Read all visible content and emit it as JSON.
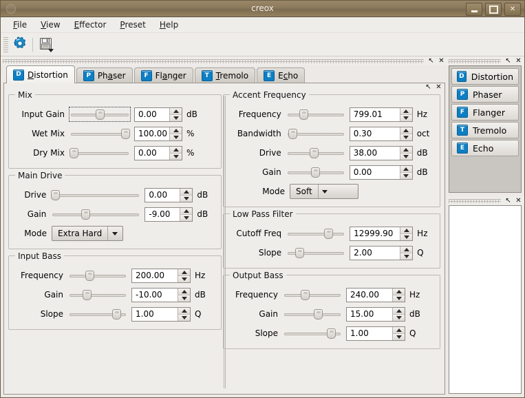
{
  "window": {
    "title": "creox",
    "minimize_label": "–",
    "maximize_label": "□",
    "close_label": "✕"
  },
  "menubar": [
    {
      "label": "File",
      "mnemonic": "F"
    },
    {
      "label": "View",
      "mnemonic": "V"
    },
    {
      "label": "Effector",
      "mnemonic": "E"
    },
    {
      "label": "Preset",
      "mnemonic": "P"
    },
    {
      "label": "Help",
      "mnemonic": "H"
    }
  ],
  "toolbar": {
    "settings_icon": "gear-icon",
    "save_icon": "floppy-save-icon"
  },
  "dock_buttons": {
    "float_label": "↖",
    "close_label": "✕"
  },
  "tabs": [
    {
      "label": "Distortion",
      "mnemonic": "D",
      "badge": "D",
      "active": true
    },
    {
      "label": "Phaser",
      "mnemonic": "a",
      "badge": "P",
      "active": false
    },
    {
      "label": "Flanger",
      "mnemonic": "l",
      "badge": "F",
      "active": false
    },
    {
      "label": "Tremolo",
      "mnemonic": "T",
      "badge": "T",
      "active": false
    },
    {
      "label": "Echo",
      "mnemonic": "c",
      "badge": "E",
      "active": false
    }
  ],
  "groups": {
    "mix": {
      "title": "Mix",
      "label_width": 72,
      "slider_width": 88,
      "spin_width": 70,
      "rows": [
        {
          "label": "Input Gain",
          "value": "0.00",
          "unit": "dB",
          "pos": 50,
          "focused": true
        },
        {
          "label": "Wet Mix",
          "value": "100.00",
          "unit": "%",
          "pos": 100,
          "focused": false
        },
        {
          "label": "Dry Mix",
          "value": "0.00",
          "unit": "%",
          "pos": 0,
          "focused": false
        }
      ]
    },
    "accent_frequency": {
      "title": "Accent Frequency",
      "label_width": 80,
      "slider_width": 86,
      "spin_width": 92,
      "rows": [
        {
          "label": "Frequency",
          "value": "799.01",
          "unit": "Hz",
          "pos": 26
        },
        {
          "label": "Bandwidth",
          "value": "0.30",
          "unit": "oct",
          "pos": 4
        },
        {
          "label": "Drive",
          "value": "38.00",
          "unit": "dB",
          "pos": 47
        },
        {
          "label": "Gain",
          "value": "0.00",
          "unit": "dB",
          "pos": 50
        }
      ],
      "mode_label": "Mode",
      "mode_value": "Soft"
    },
    "main_drive": {
      "title": "Main Drive",
      "label_width": 46,
      "slider_width": 130,
      "spin_width": 70,
      "rows": [
        {
          "label": "Drive",
          "value": "0.00",
          "unit": "dB",
          "pos": 0
        },
        {
          "label": "Gain",
          "value": "-9.00",
          "unit": "dB",
          "pos": 37
        }
      ],
      "mode_label": "Mode",
      "mode_value": "Extra Hard"
    },
    "low_pass_filter": {
      "title": "Low Pass Filter",
      "label_width": 82,
      "slider_width": 86,
      "spin_width": 92,
      "rows": [
        {
          "label": "Cutoff Freq",
          "value": "12999.90",
          "unit": "Hz",
          "pos": 75
        },
        {
          "label": "Slope",
          "value": "2.00",
          "unit": "Q",
          "pos": 17
        }
      ]
    },
    "input_bass": {
      "title": "Input Bass",
      "label_width": 70,
      "slider_width": 86,
      "spin_width": 86,
      "rows": [
        {
          "label": "Frequency",
          "value": "200.00",
          "unit": "Hz",
          "pos": 34
        },
        {
          "label": "Gain",
          "value": "-10.00",
          "unit": "dB",
          "pos": 29
        },
        {
          "label": "Slope",
          "value": "1.00",
          "unit": "Q",
          "pos": 87
        }
      ]
    },
    "output_bass": {
      "title": "Output Bass",
      "label_width": 70,
      "slider_width": 86,
      "spin_width": 86,
      "rows": [
        {
          "label": "Frequency",
          "value": "240.00",
          "unit": "Hz",
          "pos": 36
        },
        {
          "label": "Gain",
          "value": "15.00",
          "unit": "dB",
          "pos": 62
        },
        {
          "label": "Slope",
          "value": "1.00",
          "unit": "Q",
          "pos": 88
        }
      ]
    }
  },
  "effector_dock": {
    "items": [
      {
        "label": "Distortion",
        "badge": "D"
      },
      {
        "label": "Phaser",
        "badge": "P"
      },
      {
        "label": "Flanger",
        "badge": "F"
      },
      {
        "label": "Tremolo",
        "badge": "T"
      },
      {
        "label": "Echo",
        "badge": "E"
      }
    ]
  },
  "colors": {
    "titlebar": "#8c7a5d",
    "accent_icon": "#0d7fc4",
    "window_bg": "#efedea"
  }
}
